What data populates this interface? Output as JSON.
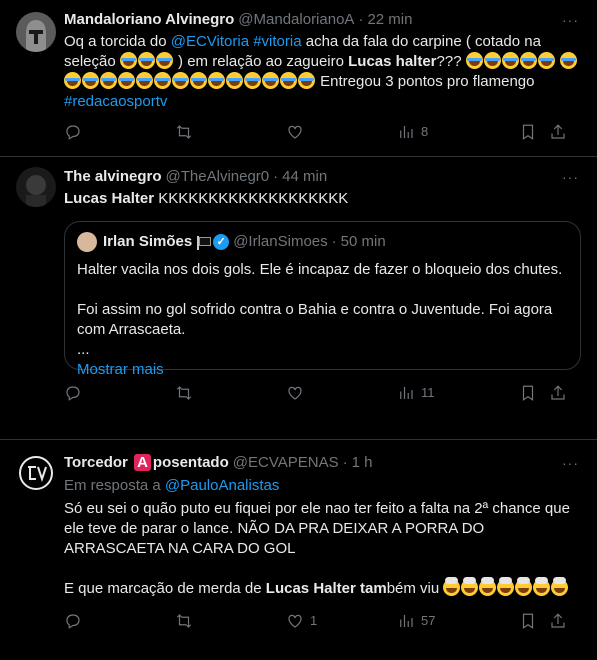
{
  "tweets": [
    {
      "name": "Mandaloriano Alvinegro",
      "handle": "@MandalorianoA",
      "time": "22 min",
      "text1": "Oq a torcida do ",
      "mention1": "@ECVitoria",
      "hashtag1": "#vitoria",
      "text2": " acha da fala do carpine ( cotado na seleção ",
      "text3": " ) em relação ao zagueiro ",
      "bold1": "Lucas halter",
      "text4": "??? ",
      "text5": " Entregou 3 pontos pro flamengo ",
      "hashtag2": "#redacaosportv",
      "views": "8"
    },
    {
      "name": "The alvinegro",
      "handle": "@TheAlvinegr0",
      "time": "44 min",
      "bold1": "Lucas Halter",
      "text1": " KKKKKKKKKKKKKKKKKKK",
      "quote": {
        "name": "Irlan Simões",
        "handle": "@IrlanSimoes",
        "time": "50 min",
        "line1": "Halter vacila nos dois gols. Ele é incapaz de fazer o bloqueio dos chutes.",
        "line2": "Foi assim no gol sofrido contra o Bahia e contra o Juventude. Foi agora com Arrascaeta.",
        "line3": "...",
        "more": "Mostrar mais"
      },
      "views": "11"
    },
    {
      "name_a": "Torcedor ",
      "name_badge": "A",
      "name_b": "posentado",
      "handle": "@ECVAPENAS",
      "time": "1 h",
      "reply_prefix": "Em resposta a ",
      "reply_to": "@PauloAnalistas",
      "para1": "Só eu sei o quão puto eu fiquei por ele nao ter feito a falta na 2ª chance que ele teve de parar o lance. NÃO DA PRA DEIXAR A PORRA DO ARRASCAETA NA CARA DO GOL",
      "para2a": "E que marcação de merda de ",
      "bold1": "Lucas Halter",
      "bold2": " tam",
      "para2b": "bém viu ",
      "likes": "1",
      "views": "57"
    }
  ],
  "separator": "·",
  "more_icon": "···",
  "icons": [
    "reply-icon",
    "retweet-icon",
    "like-icon",
    "views-icon",
    "bookmark-icon",
    "share-icon"
  ],
  "colors": {
    "accent": "#1d9bf0",
    "muted": "#71767b",
    "border": "#2f3336",
    "background": "#000000"
  }
}
